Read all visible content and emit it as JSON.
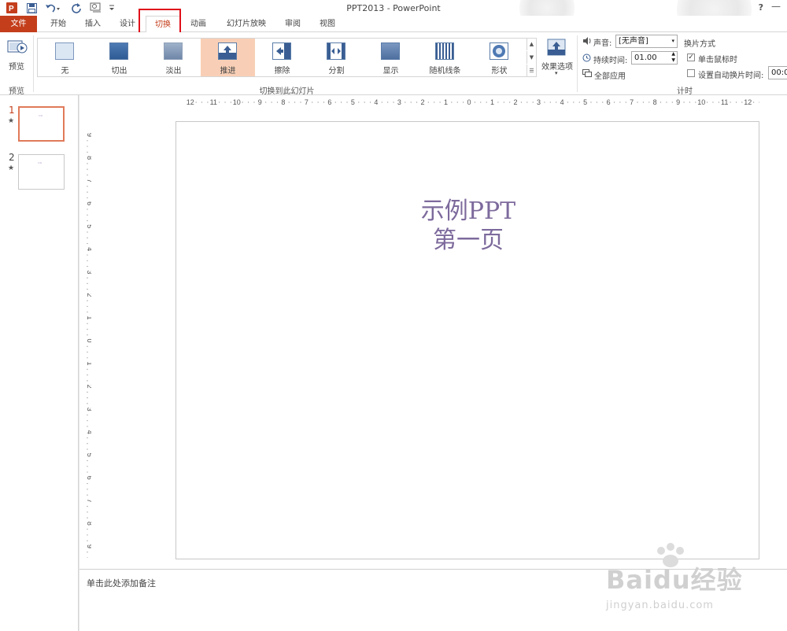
{
  "titlebar": {
    "title": "PPT2013 - PowerPoint",
    "help": "?",
    "minimize": "—"
  },
  "tabs": [
    {
      "label": "文件"
    },
    {
      "label": "开始"
    },
    {
      "label": "插入"
    },
    {
      "label": "设计"
    },
    {
      "label": "切换"
    },
    {
      "label": "动画"
    },
    {
      "label": "幻灯片放映"
    },
    {
      "label": "审阅"
    },
    {
      "label": "视图"
    }
  ],
  "ribbon": {
    "preview": {
      "button": "预览",
      "group_label": "预览"
    },
    "transitions": {
      "group_label": "切换到此幻灯片",
      "items": [
        {
          "label": "无"
        },
        {
          "label": "切出"
        },
        {
          "label": "淡出"
        },
        {
          "label": "推进"
        },
        {
          "label": "擦除"
        },
        {
          "label": "分割"
        },
        {
          "label": "显示"
        },
        {
          "label": "随机线条"
        },
        {
          "label": "形状"
        }
      ],
      "selected": "推进",
      "effect_options": "效果选项"
    },
    "timing": {
      "group_label": "计时",
      "sound_label": "声音:",
      "sound_value": "[无声音]",
      "duration_label": "持续时间:",
      "duration_value": "01.00",
      "apply_all": "全部应用",
      "advance_header": "换片方式",
      "on_click": "单击鼠标时",
      "on_click_checked": true,
      "after_label": "设置自动换片时间:",
      "after_value": "00:0"
    }
  },
  "thumbnails": [
    {
      "number": "1",
      "star": "★",
      "selected": true
    },
    {
      "number": "2",
      "star": "★",
      "selected": false
    }
  ],
  "slide": {
    "line1": "示例PPT",
    "line2": "第一页"
  },
  "ruler": {
    "horizontal": [
      "12",
      "11",
      "10",
      "9",
      "8",
      "7",
      "6",
      "5",
      "4",
      "3",
      "2",
      "1",
      "0",
      "1",
      "2",
      "3",
      "4",
      "5",
      "6",
      "7",
      "8",
      "9",
      "10",
      "11",
      "12"
    ],
    "vertical": [
      "9",
      "8",
      "7",
      "6",
      "5",
      "4",
      "3",
      "2",
      "1",
      "0",
      "1",
      "2",
      "3",
      "4",
      "5",
      "6",
      "7",
      "8",
      "9"
    ]
  },
  "notes": {
    "placeholder": "单击此处添加备注"
  },
  "watermark": {
    "logo": "Baidu经验",
    "sub": "jingyan.baidu.com"
  },
  "colors": {
    "accent": "#c43e1c",
    "selected_tile": "#f8cfb6",
    "slide_text": "#7d6a9c",
    "highlight_box": "#e0101a"
  }
}
